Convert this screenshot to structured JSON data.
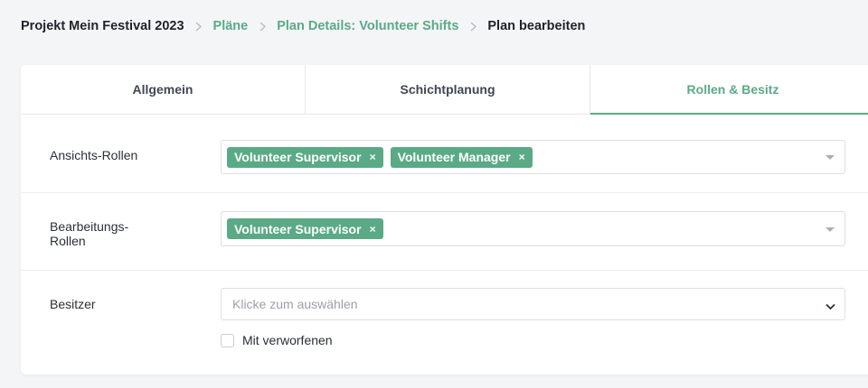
{
  "breadcrumb": {
    "project": "Projekt Mein Festival 2023",
    "plans": "Pläne",
    "plan_details": "Plan Details: Volunteer Shifts",
    "current": "Plan bearbeiten"
  },
  "tabs": [
    {
      "label": "Allgemein",
      "active": false
    },
    {
      "label": "Schichtplanung",
      "active": false
    },
    {
      "label": "Rollen & Besitz",
      "active": true
    }
  ],
  "form": {
    "view_roles": {
      "label": "Ansichts-Rollen",
      "tags": [
        "Volunteer Supervisor",
        "Volunteer Manager"
      ]
    },
    "edit_roles": {
      "label_line1": "Bearbeitungs-",
      "label_line2": "Rollen",
      "tags": [
        "Volunteer Supervisor"
      ]
    },
    "owner": {
      "label": "Besitzer",
      "placeholder": "Klicke zum auswählen"
    },
    "include_discarded": {
      "label": "Mit verworfenen",
      "checked": false
    }
  },
  "tag_remove_glyph": "×",
  "colors": {
    "accent": "#5aaa86",
    "text": "#2a2f36",
    "background": "#f4f5f7"
  }
}
